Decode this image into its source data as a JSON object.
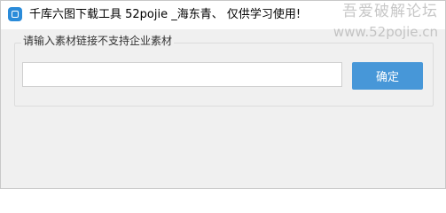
{
  "window": {
    "title": "千库六图下载工具 52pojie _海东青、 仅供学习使用!",
    "icon": "app-icon"
  },
  "watermark": {
    "line1": "吾爱破解论坛",
    "line2": "www.52pojie.cn"
  },
  "form": {
    "label": "请输入素材链接不支持企业素材",
    "input_value": "",
    "confirm_label": "确定"
  },
  "colors": {
    "accent": "#4797d8",
    "window_bg": "#f0f0f0",
    "titlebar_bg": "#ffffff"
  }
}
